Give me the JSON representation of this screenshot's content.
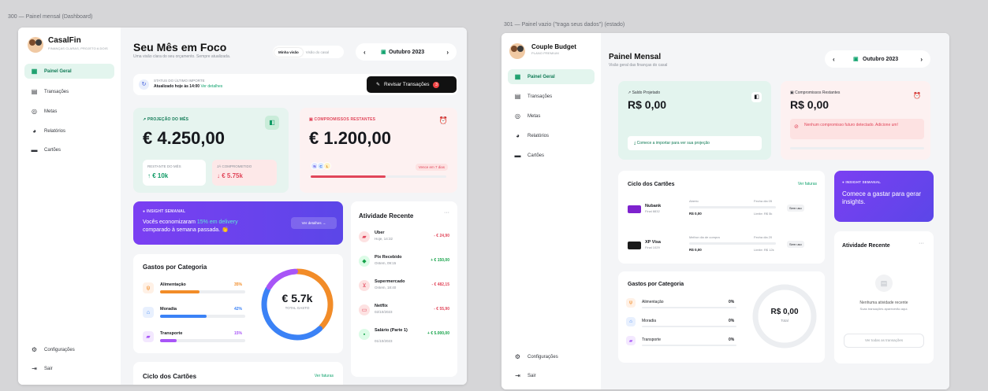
{
  "left": {
    "frame_title": "300 — Painel mensal (Dashboard)",
    "brand": {
      "name": "CasalFin",
      "tagline": "FINANÇAS CLARAS, PROJETO A DOIS"
    },
    "nav": [
      {
        "label": "Painel Geral",
        "icon": "grid-icon",
        "active": true
      },
      {
        "label": "Transações",
        "icon": "receipt-icon"
      },
      {
        "label": "Metas",
        "icon": "target-icon"
      },
      {
        "label": "Relatórios",
        "icon": "pie-icon"
      },
      {
        "label": "Cartões",
        "icon": "card-icon"
      }
    ],
    "footer_nav": [
      {
        "label": "Configurações",
        "icon": "gear-icon"
      },
      {
        "label": "Sair",
        "icon": "logout-icon"
      }
    ],
    "header": {
      "title": "Seu Mês em Foco",
      "subtitle": "Uma visão clara do seu orçamento. Sempre atualizada.",
      "toggle": [
        "Minha visão",
        "Visão do casal"
      ],
      "month": "Outubro 2023"
    },
    "import": {
      "label": "STATUS DO ÚLTIMO IMPORTE",
      "text": "Atualizado hoje às 14:00",
      "link": "Ver detalhes",
      "button": "Revisar Transações",
      "badge": "3"
    },
    "projection": {
      "label": "PROJEÇÃO DO MÊS",
      "value": "€ 4.250,00",
      "remaining_label": "RESTANTE DO MÊS",
      "remaining_value": "↑ € 10k",
      "committed_label": "JÁ COMPROMETIDO",
      "committed_value": "↓ € 5.75k"
    },
    "commitments": {
      "label": "COMPROMISSOS RESTANTES",
      "value": "€ 1.200,00",
      "avatars": [
        "N",
        "C",
        "L"
      ],
      "due": "Vence em 7 dias",
      "progress": 0.55
    },
    "insight": {
      "label": "INSIGHT SEMANAL",
      "text_before": "Vocês economizaram ",
      "highlight": "15% em delivery",
      "text_after": "comparado à semana passada. 👏",
      "button": "Ver detalhes →"
    },
    "categories": {
      "title": "Gastos por Categoria",
      "total": "€ 5.7k",
      "total_label": "TOTAL GASTO",
      "items": [
        {
          "name": "Alimentação",
          "pct": "35%",
          "value": 35,
          "color": "#f28c28"
        },
        {
          "name": "Moradia",
          "pct": "42%",
          "value": 42,
          "color": "#3b82f6"
        },
        {
          "name": "Transporte",
          "pct": "15%",
          "value": 15,
          "color": "#a855f7"
        }
      ]
    },
    "activity": {
      "title": "Atividade Recente",
      "more": "···",
      "items": [
        {
          "name": "Uber",
          "date": "Hoje, 14:32",
          "amount": "- € 24,90",
          "positive": false,
          "color": "#fde2e2",
          "icon": "car-icon"
        },
        {
          "name": "Pix Recebido",
          "date": "Ontem, 09:15",
          "amount": "+ € 150,00",
          "positive": true,
          "color": "#dcfce7",
          "icon": "pix-icon"
        },
        {
          "name": "Supermercado",
          "date": "Ontem, 18:40",
          "amount": "- € 482,15",
          "positive": false,
          "color": "#fde2e2",
          "icon": "cart-icon"
        },
        {
          "name": "Netflix",
          "date": "02/10/2023",
          "amount": "- € 55,90",
          "positive": false,
          "color": "#fde2e2",
          "icon": "tv-icon"
        },
        {
          "name": "Salário (Parte 1)",
          "date": "01/10/2023",
          "amount": "+ € 5.000,00",
          "positive": true,
          "color": "#dcfce7",
          "icon": "briefcase-icon"
        }
      ]
    },
    "cards_cycle": {
      "title": "Ciclo dos Cartões",
      "link": "Ver faturas"
    }
  },
  "right": {
    "frame_title": "301 — Painel vazio (\"traga seus dados\") (estado)",
    "brand": {
      "name": "Couple Budget",
      "tagline": "PLANO PREMIUM"
    },
    "nav": [
      {
        "label": "Painel Geral",
        "icon": "grid-icon",
        "active": true
      },
      {
        "label": "Transações",
        "icon": "receipt-icon"
      },
      {
        "label": "Metas",
        "icon": "target-icon"
      },
      {
        "label": "Relatórios",
        "icon": "pie-icon"
      },
      {
        "label": "Cartões",
        "icon": "card-icon"
      }
    ],
    "footer_nav": [
      {
        "label": "Configurações",
        "icon": "gear-icon"
      },
      {
        "label": "Sair",
        "icon": "logout-icon"
      }
    ],
    "header": {
      "title": "Painel Mensal",
      "subtitle": "Visão geral das finanças do casal",
      "month": "Outubro 2023"
    },
    "balance": {
      "label": "Saldo Projetado",
      "value": "R$ 0,00",
      "cta": "Comece a importar para ver sua projeção"
    },
    "commitments": {
      "label": "Compromissos Restantes",
      "value": "R$ 0,00",
      "notice": "Nenhum compromisso futuro detectado. Adicione um!"
    },
    "cards_cycle": {
      "title": "Ciclo dos Cartões",
      "link": "Ver faturas",
      "cards": [
        {
          "name": "Nubank",
          "ending": "Final 8832",
          "open_label": "Aberto",
          "close_label": "Fecha dia 05",
          "amount": "R$ 0,00",
          "limit": "Limite: R$ 5k",
          "badge": "Sem uso",
          "color": "#7e22ce"
        },
        {
          "name": "XP Visa",
          "ending": "Final 1029",
          "open_label": "Melhor dia de compra",
          "close_label": "Fecha dia 20",
          "amount": "R$ 0,00",
          "limit": "Limite: R$ 12k",
          "badge": "Sem uso",
          "color": "#1a1a1a"
        }
      ]
    },
    "insight": {
      "label": "INSIGHT SEMANAL",
      "text": "Comece a gastar para gerar insights."
    },
    "categories": {
      "title": "Gastos por Categoria",
      "total": "R$ 0,00",
      "total_label": "Total",
      "items": [
        {
          "name": "Alimentação",
          "pct": "0%"
        },
        {
          "name": "Moradia",
          "pct": "0%"
        },
        {
          "name": "Transporte",
          "pct": "0%"
        }
      ]
    },
    "activity": {
      "title": "Atividade Recente",
      "more": "···",
      "empty_title": "Nenhuma atividade recente",
      "empty_sub": "Suas transações aparecerão aqui.",
      "button": "Ver todas as transações"
    }
  }
}
